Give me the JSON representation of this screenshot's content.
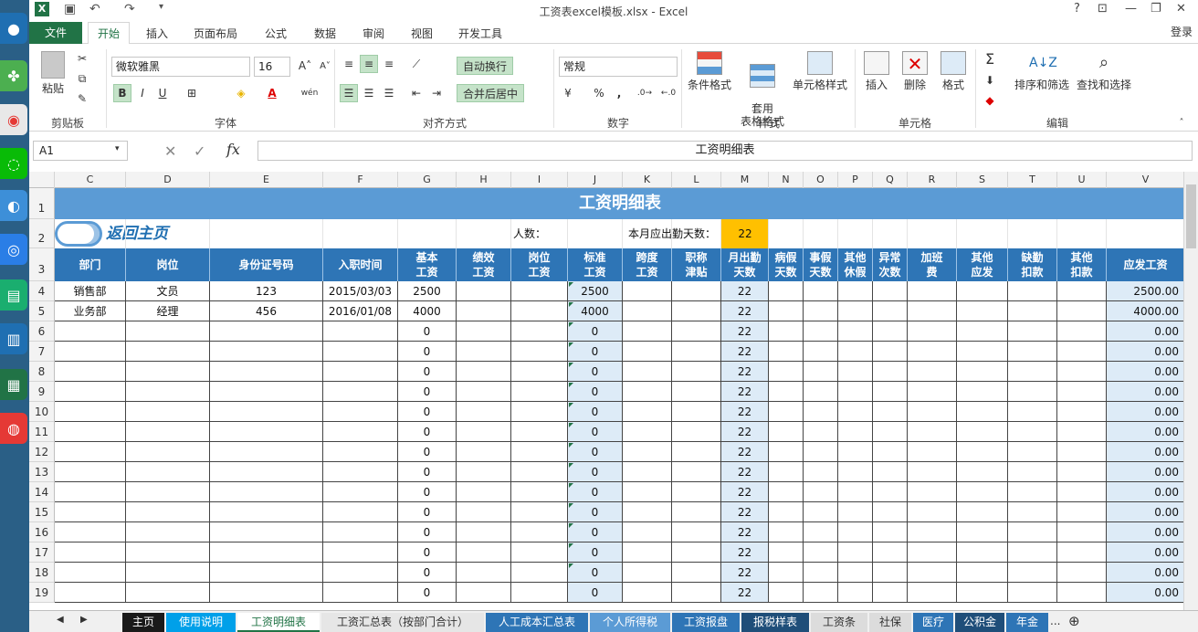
{
  "window": {
    "title": "工资表excel模板.xlsx - Excel",
    "help": "?",
    "login": "登录"
  },
  "ribbon_tabs": [
    "文件",
    "开始",
    "插入",
    "页面布局",
    "公式",
    "数据",
    "审阅",
    "视图",
    "开发工具"
  ],
  "ribbon": {
    "clipboard": {
      "paste": "粘贴",
      "label": "剪贴板"
    },
    "font": {
      "name": "微软雅黑",
      "size": "16",
      "label": "字体",
      "bold": "B",
      "italic": "I",
      "underline": "U",
      "phonetic": "wén"
    },
    "alignment": {
      "wrap": "自动换行",
      "merge": "合并后居中",
      "label": "对齐方式"
    },
    "number": {
      "format": "常规",
      "label": "数字",
      "percent": "%",
      "comma": ","
    },
    "styles": {
      "conditional": "条件格式",
      "table": "套用\n表格格式",
      "cell": "单元格样式",
      "label": "样式"
    },
    "cells": {
      "insert": "插入",
      "delete": "删除",
      "format": "格式",
      "label": "单元格"
    },
    "editing": {
      "sort": "排序和筛选",
      "find": "查找和选择",
      "label": "编辑"
    }
  },
  "formula_bar": {
    "name_box": "A1",
    "fx": "fx",
    "content": "工资明细表"
  },
  "columns": [
    "C",
    "D",
    "E",
    "F",
    "G",
    "H",
    "I",
    "J",
    "K",
    "L",
    "M",
    "N",
    "O",
    "P",
    "Q",
    "R",
    "S",
    "T",
    "U",
    "V"
  ],
  "rows": [
    "1",
    "2",
    "3",
    "4",
    "5",
    "6",
    "7",
    "8",
    "9",
    "10",
    "11",
    "12",
    "13",
    "14",
    "15",
    "16",
    "17",
    "18",
    "19"
  ],
  "sheet": {
    "title": "工资明细表",
    "back_home": "返回主页",
    "headcount_label": "人数：",
    "workdays_label": "本月应出勤天数：",
    "workdays_value": "22",
    "headers": [
      "部门",
      "岗位",
      "身份证号码",
      "入职时间",
      "基本\n工资",
      "绩效\n工资",
      "岗位\n工资",
      "标准\n工资",
      "跨度\n工资",
      "职称\n津贴",
      "月出勤\n天数",
      "病假\n天数",
      "事假\n天数",
      "其他\n休假",
      "异常\n次数",
      "加班\n费",
      "其他\n应发",
      "缺勤\n扣款",
      "其他\n扣款",
      "应发工资"
    ],
    "data_rows": [
      {
        "dept": "销售部",
        "post": "文员",
        "id": "123",
        "date": "2015/03/03",
        "base": "2500",
        "std": "2500",
        "days": "22",
        "gross": "2500.00"
      },
      {
        "dept": "业务部",
        "post": "经理",
        "id": "456",
        "date": "2016/01/08",
        "base": "4000",
        "std": "4000",
        "days": "22",
        "gross": "4000.00"
      }
    ],
    "empty_row": {
      "base": "0",
      "std": "0",
      "days": "22",
      "gross": "0.00"
    }
  },
  "sheet_tabs": [
    {
      "label": "主页",
      "color": "#1a1a1a"
    },
    {
      "label": "使用说明",
      "color": "#00a0e9"
    },
    {
      "label": "工资明细表",
      "color": "#ffffff"
    },
    {
      "label": "工资汇总表（按部门合计）",
      "color": "#e6e6e6"
    },
    {
      "label": "人工成本汇总表",
      "color": "#2e75b6"
    },
    {
      "label": "个人所得税",
      "color": "#5b9bd5"
    },
    {
      "label": "工资报盘",
      "color": "#2e75b6"
    },
    {
      "label": "报税样表",
      "color": "#1f4e79"
    },
    {
      "label": "工资条",
      "color": "#dcdcdc"
    },
    {
      "label": "社保",
      "color": "#dcdcdc"
    },
    {
      "label": "医疗",
      "color": "#2e75b6"
    },
    {
      "label": "公积金",
      "color": "#1f4e79"
    },
    {
      "label": "年金",
      "color": "#2e75b6"
    }
  ],
  "sheet_more": "...",
  "colors": {
    "accent": "#217346",
    "header_blue": "#2e75b6",
    "title_band": "#5b9bd5",
    "highlight": "#ffc000",
    "light_blue": "#ddebf7"
  }
}
